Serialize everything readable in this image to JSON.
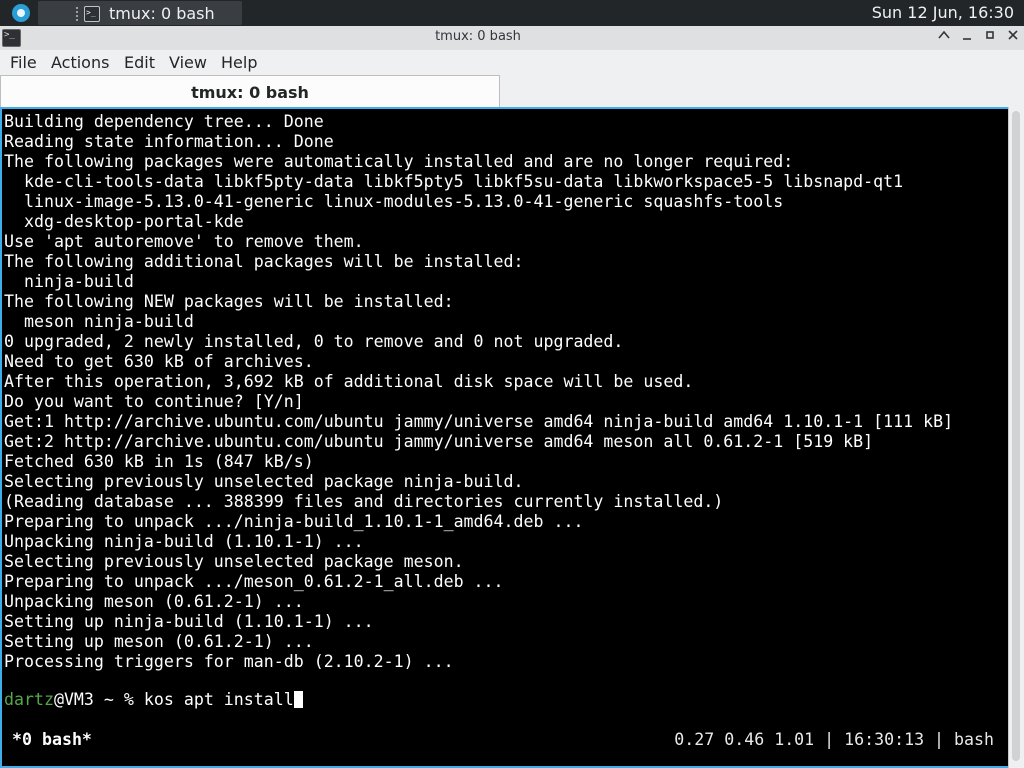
{
  "panel": {
    "task_label": "tmux: 0 bash",
    "clock": "Sun 12 Jun, 16:30"
  },
  "window": {
    "title": "tmux: 0 bash",
    "icon_glyph": ">_"
  },
  "menu": [
    "File",
    "Actions",
    "Edit",
    "View",
    "Help"
  ],
  "tab": {
    "label": "tmux: 0 bash"
  },
  "terminal": {
    "lines": [
      "Building dependency tree... Done",
      "Reading state information... Done",
      "The following packages were automatically installed and are no longer required:",
      "  kde-cli-tools-data libkf5pty-data libkf5pty5 libkf5su-data libkworkspace5-5 libsnapd-qt1",
      "  linux-image-5.13.0-41-generic linux-modules-5.13.0-41-generic squashfs-tools",
      "  xdg-desktop-portal-kde",
      "Use 'apt autoremove' to remove them.",
      "The following additional packages will be installed:",
      "  ninja-build",
      "The following NEW packages will be installed:",
      "  meson ninja-build",
      "0 upgraded, 2 newly installed, 0 to remove and 0 not upgraded.",
      "Need to get 630 kB of archives.",
      "After this operation, 3,692 kB of additional disk space will be used.",
      "Do you want to continue? [Y/n]",
      "Get:1 http://archive.ubuntu.com/ubuntu jammy/universe amd64 ninja-build amd64 1.10.1-1 [111 kB]",
      "Get:2 http://archive.ubuntu.com/ubuntu jammy/universe amd64 meson all 0.61.2-1 [519 kB]",
      "Fetched 630 kB in 1s (847 kB/s)",
      "Selecting previously unselected package ninja-build.",
      "(Reading database ... 388399 files and directories currently installed.)",
      "Preparing to unpack .../ninja-build_1.10.1-1_amd64.deb ...",
      "Unpacking ninja-build (1.10.1-1) ...",
      "Selecting previously unselected package meson.",
      "Preparing to unpack .../meson_0.61.2-1_all.deb ...",
      "Unpacking meson (0.61.2-1) ...",
      "Setting up ninja-build (1.10.1-1) ...",
      "Setting up meson (0.61.2-1) ...",
      "Processing triggers for man-db (2.10.2-1) ..."
    ],
    "prompt_user": "dartz",
    "prompt_rest": "@VM3 ~ % ",
    "command": "kos apt install",
    "status_left": "*0 bash*",
    "status_right": "0.27 0.46 1.01 | 16:30:13 | bash",
    "prompt_user_color": "#54a848",
    "selection_color": "#3daee9"
  }
}
